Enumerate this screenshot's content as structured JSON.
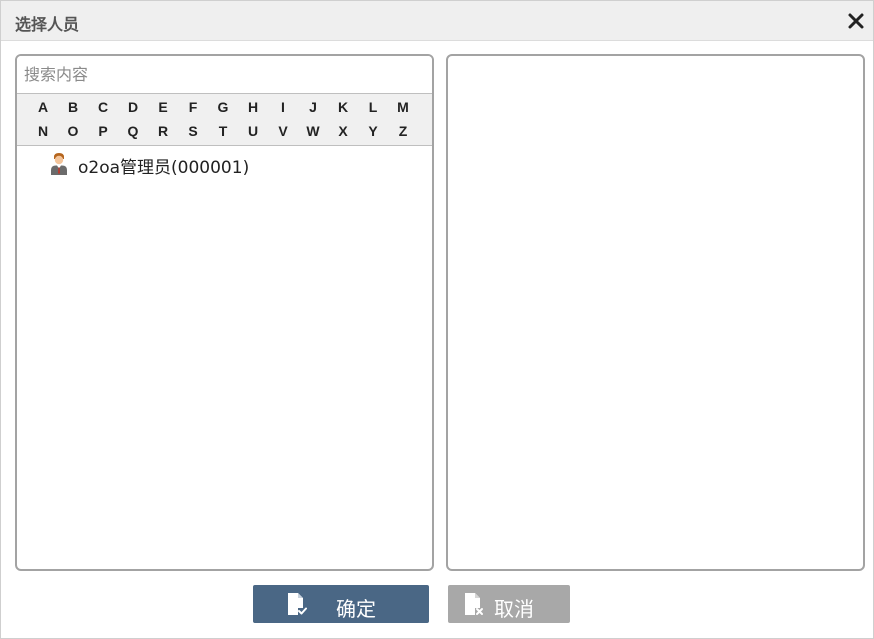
{
  "dialog": {
    "title": "选择人员"
  },
  "search": {
    "placeholder": "搜索内容",
    "value": ""
  },
  "alphabet": {
    "row1": [
      "A",
      "B",
      "C",
      "D",
      "E",
      "F",
      "G",
      "H",
      "I",
      "J",
      "K",
      "L",
      "M"
    ],
    "row2": [
      "N",
      "O",
      "P",
      "Q",
      "R",
      "S",
      "T",
      "U",
      "V",
      "W",
      "X",
      "Y",
      "Z"
    ]
  },
  "people": [
    {
      "name": "o2oa管理员(000001)",
      "icon": "person-icon"
    }
  ],
  "buttons": {
    "ok_label": "确定",
    "cancel_label": "取消"
  },
  "colors": {
    "ok_button": "#4a6785",
    "cancel_button": "#a8a8a8",
    "titlebar": "#efefef",
    "panel_border": "#a3a3a3"
  }
}
